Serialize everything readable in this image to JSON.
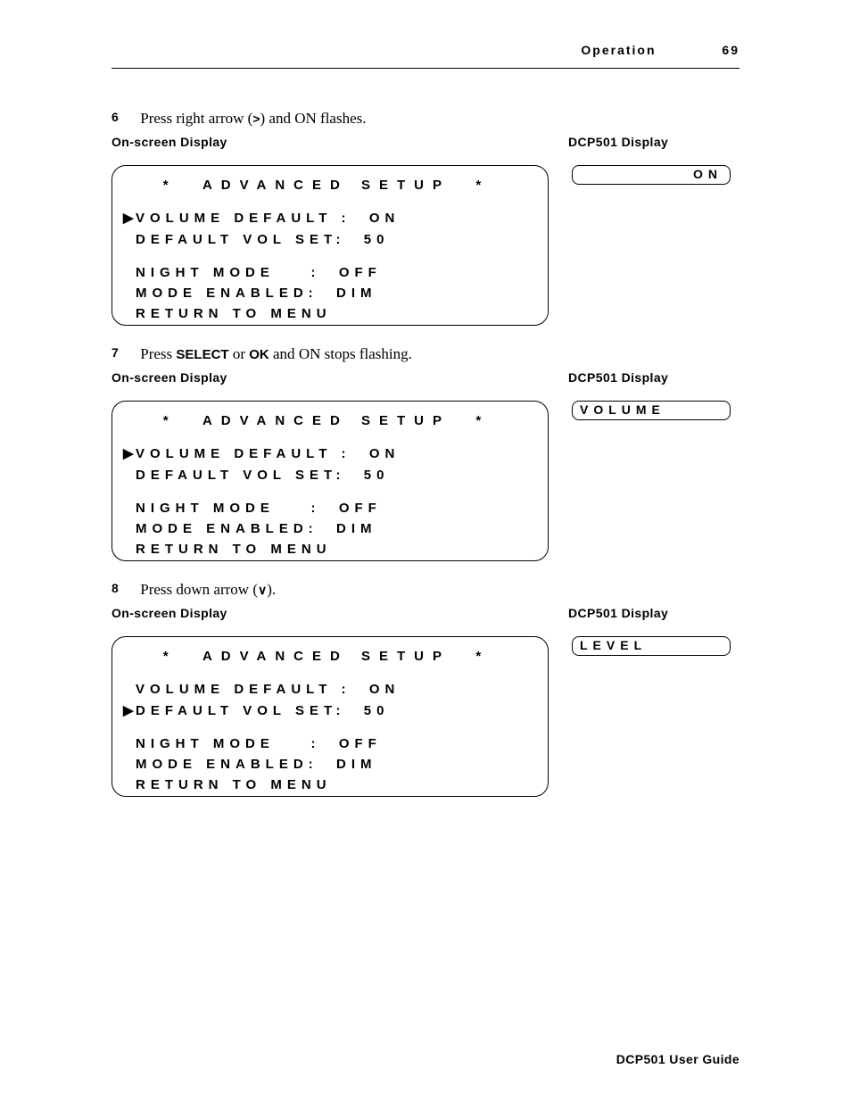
{
  "header": {
    "section": "Operation",
    "page": "69"
  },
  "steps": {
    "s6": {
      "num": "6",
      "pre": "Press right arrow (",
      "sym": ">",
      "mid": ") and ",
      "flash": "ON",
      "post": " flashes."
    },
    "s7": {
      "num": "7",
      "pre": "Press ",
      "b1": "SELECT",
      "or": " or ",
      "b2": "OK",
      "mid": " and ",
      "flash": "ON",
      "post": " stops flashing."
    },
    "s8": {
      "num": "8",
      "pre": "Press down arrow (",
      "sym": "∨",
      "post": ")."
    }
  },
  "labels": {
    "osd": "On-screen Display",
    "dcp": "DCP501 Display"
  },
  "menu": {
    "title_star": "*",
    "title": "ADVANCED  SETUP",
    "items": {
      "vol_def": {
        "label": "VOLUME DEFAULT :",
        "value": "ON"
      },
      "def_vol": {
        "label": "DEFAULT VOL SET:",
        "value": "50"
      },
      "night": {
        "label": "NIGHT MODE    :",
        "value": "OFF"
      },
      "mode_en": {
        "label": "MODE ENABLED:",
        "value": "DIM"
      },
      "return": {
        "label": "RETURN TO MENU",
        "value": ""
      }
    }
  },
  "dcp": {
    "d6": "ON",
    "d7": "VOLUME",
    "d8": "LEVEL"
  },
  "footer": "DCP501 User Guide"
}
